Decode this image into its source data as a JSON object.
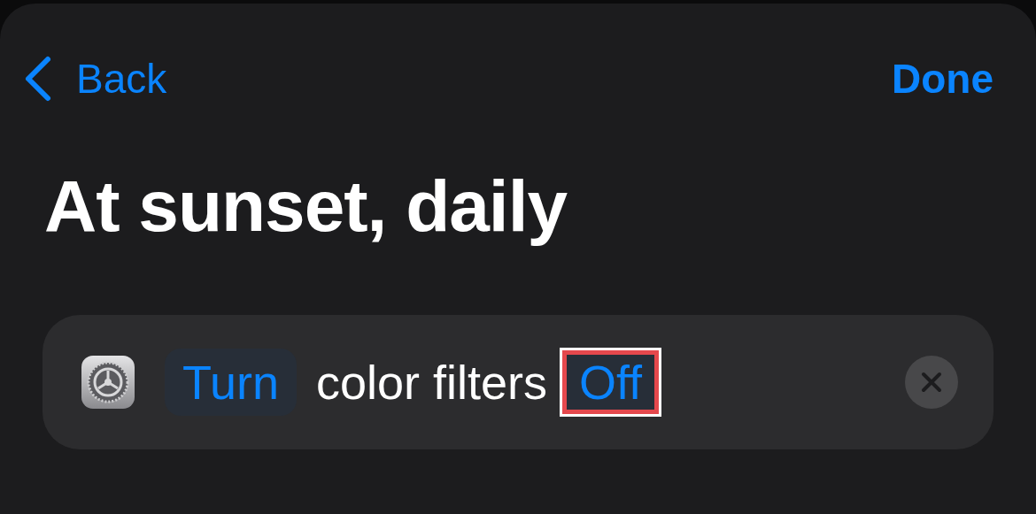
{
  "navigation": {
    "back": {
      "label": "Back"
    },
    "done": {
      "label": "Done"
    }
  },
  "title": "At sunset, daily",
  "action": {
    "tokens": [
      {
        "kind": "parameter",
        "text": "Turn",
        "highlighted": false
      },
      {
        "kind": "text",
        "text": "color filters"
      },
      {
        "kind": "parameter",
        "text": "Off",
        "highlighted": true
      }
    ]
  }
}
